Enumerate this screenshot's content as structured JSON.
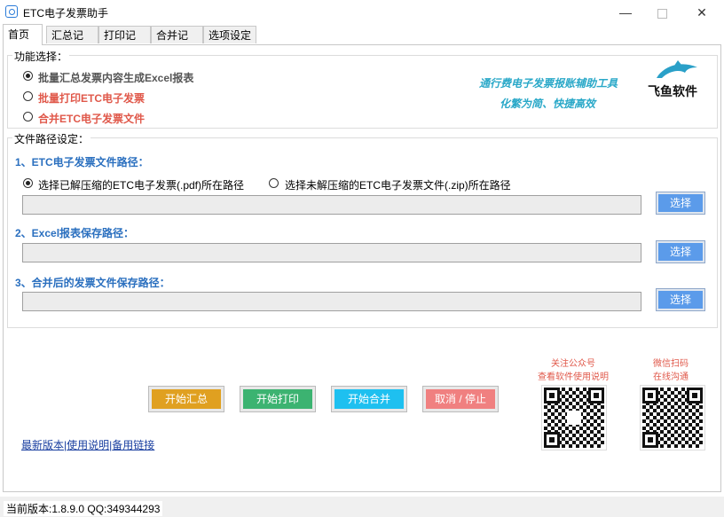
{
  "window": {
    "title": "ETC电子发票助手",
    "min": "—",
    "close": "✕"
  },
  "tabs": [
    {
      "label": "首页"
    },
    {
      "label": "汇总记录"
    },
    {
      "label": "打印记录"
    },
    {
      "label": "合并记录"
    },
    {
      "label": "选项设定"
    }
  ],
  "function_group": {
    "title": "功能选择：",
    "options": [
      {
        "label": "批量汇总发票内容生成Excel报表",
        "selected": true
      },
      {
        "label": "批量打印ETC电子发票",
        "selected": false
      },
      {
        "label": "合并ETC电子发票文件",
        "selected": false
      }
    ],
    "slogan_line1": "通行费电子发票报账辅助工具",
    "slogan_line2": "化繁为简、快捷高效",
    "brand": "飞鱼软件"
  },
  "path_group": {
    "title": "文件路径设定：",
    "section1": "1、ETC电子发票文件路径：",
    "radio_pdf": "选择已解压缩的ETC电子发票(.pdf)所在路径",
    "radio_zip": "选择未解压缩的ETC电子发票文件(.zip)所在路径",
    "section2": "2、Excel报表保存路径：",
    "section3": "3、合并后的发票文件保存路径：",
    "path1_value": "",
    "path2_value": "",
    "path3_value": "",
    "select_label": "选择"
  },
  "actions": {
    "start_summary": "开始汇总",
    "start_print": "开始打印",
    "start_merge": "开始合并",
    "cancel_stop": "取消 / 停止",
    "colors": {
      "summary": "#e0a020",
      "print": "#3cb371",
      "merge": "#1ec0f0",
      "cancel": "#f08080"
    }
  },
  "links": {
    "latest": "最新版本",
    "sep1": "|",
    "manual": "使用说明",
    "sep2": "|",
    "backup": "备用链接"
  },
  "qr": {
    "public_line1": "关注公众号",
    "public_line2": "查看软件使用说明",
    "wechat_line1": "微信扫码",
    "wechat_line2": "在线沟通"
  },
  "status": {
    "text": "当前版本:1.8.9.0  QQ:349344293"
  }
}
